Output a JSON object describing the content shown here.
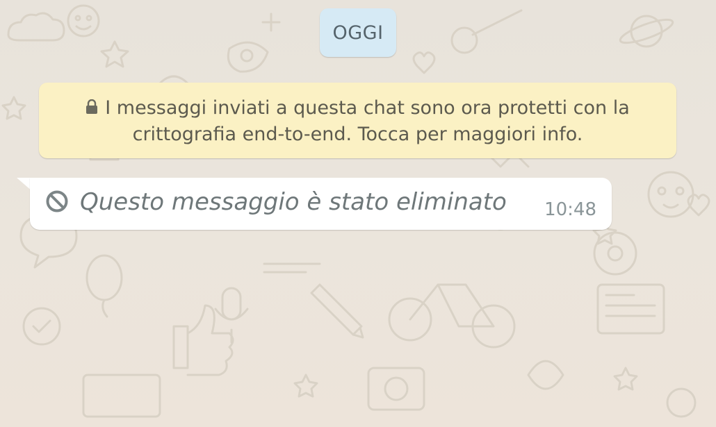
{
  "chat": {
    "date_separator": "OGGI",
    "encryption_notice": {
      "icon": "lock-icon",
      "line1": "I messaggi inviati a questa chat sono ora protetti con la",
      "line2": "crittografia end-to-end. Tocca per maggiori info."
    },
    "messages": [
      {
        "direction": "incoming",
        "icon": "ban-icon",
        "text": "Questo messaggio è stato eliminato",
        "time": "10:48"
      }
    ]
  },
  "colors": {
    "wallpaper": "#ebe5dc",
    "date_chip": "#d6eaf5",
    "notice_bubble": "#fbf1c4",
    "message_bubble": "#ffffff"
  }
}
